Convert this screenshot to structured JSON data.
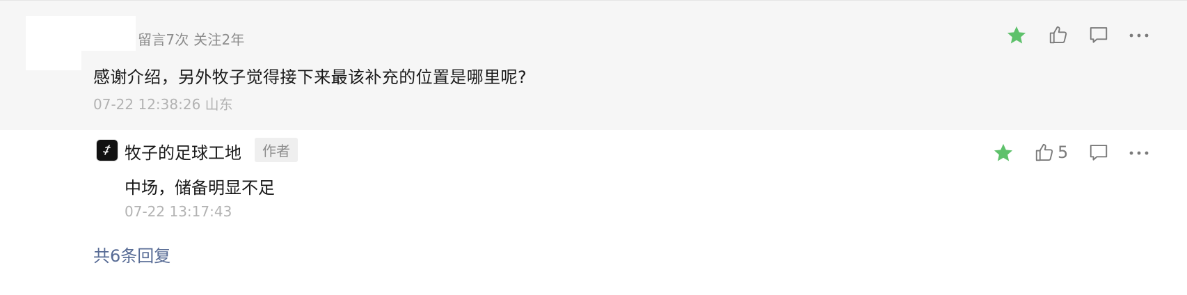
{
  "comment": {
    "meta": "留言7次 关注2年",
    "text": "感谢介绍，另外牧子觉得接下来最该补充的位置是哪里呢?",
    "time": "07-22 12:38:26 山东",
    "actions": {
      "star_icon": "star-icon",
      "like_icon": "thumbs-up-icon",
      "reply_icon": "comment-icon",
      "more_icon": "more-icon"
    }
  },
  "reply": {
    "author_name": "牧子的足球工地",
    "author_tag": "作者",
    "text": "中场，储备明显不足",
    "time": "07-22 13:17:43",
    "like_count": "5",
    "actions": {
      "star_icon": "star-icon",
      "like_icon": "thumbs-up-icon",
      "reply_icon": "comment-icon",
      "more_icon": "more-icon"
    }
  },
  "more_replies": "共6条回复",
  "colors": {
    "star": "#5ec16b",
    "link": "#576b95",
    "block_bg": "#f6f6f6"
  }
}
